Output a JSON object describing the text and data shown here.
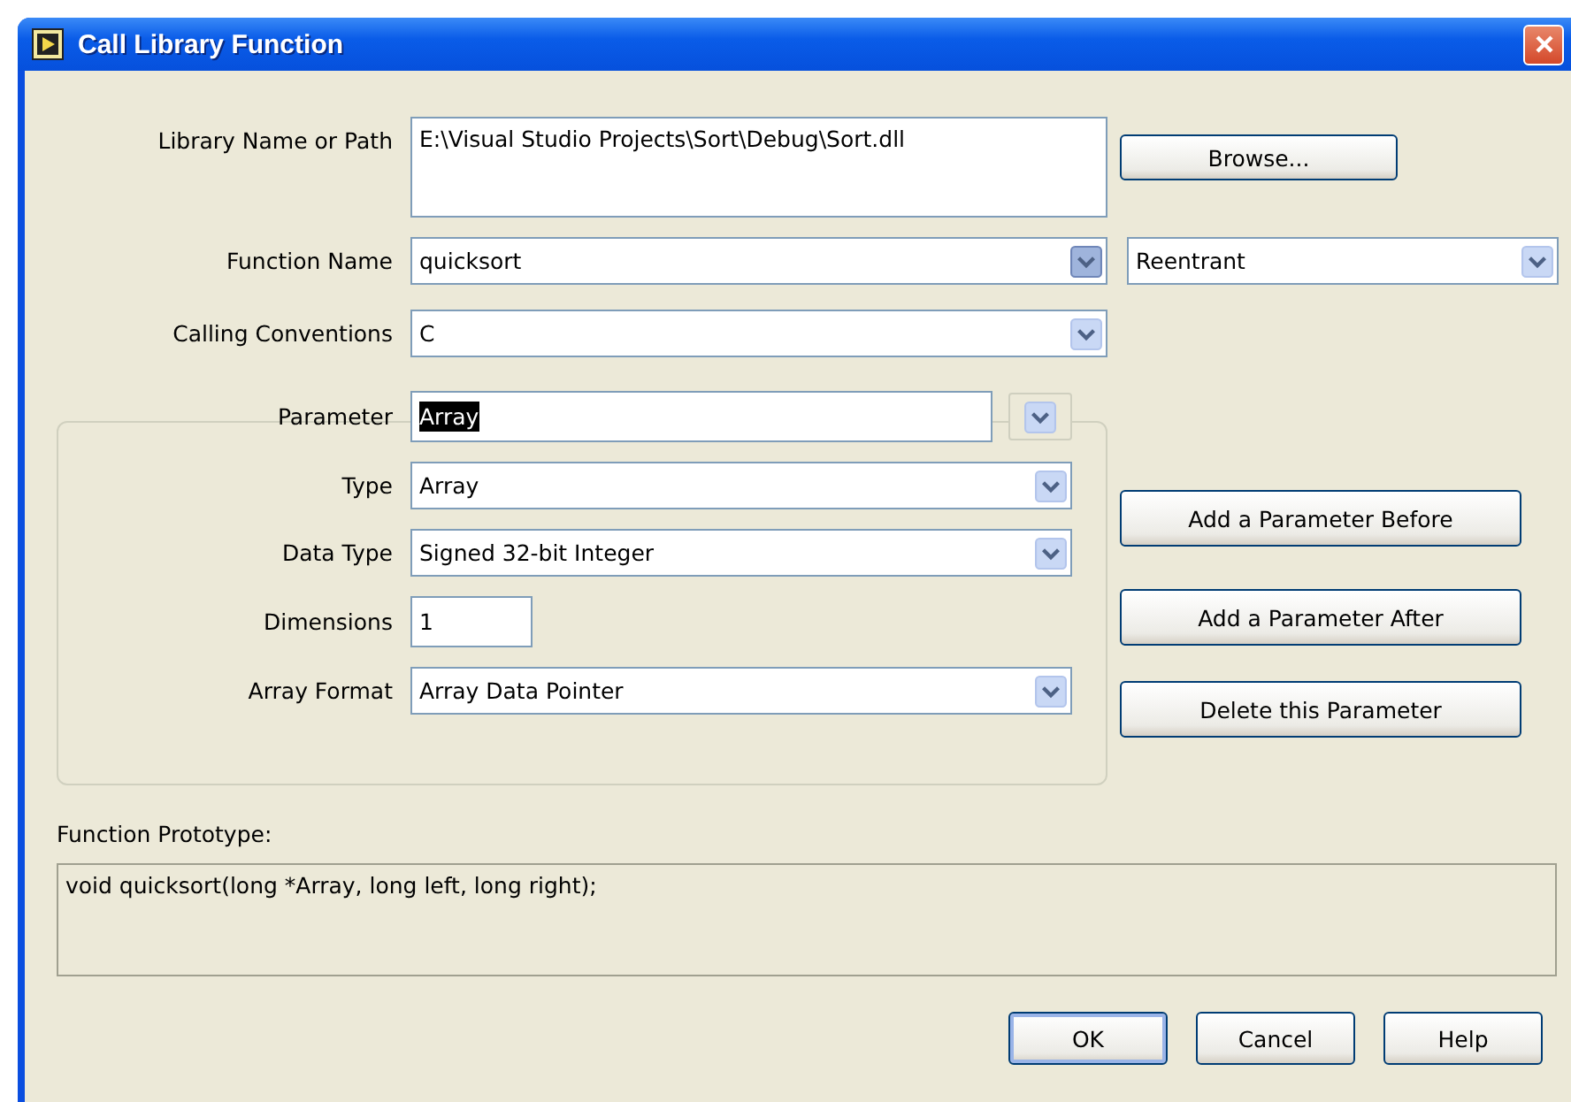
{
  "window": {
    "title": "Call Library Function"
  },
  "library": {
    "label": "Library Name or Path",
    "value": "E:\\Visual Studio Projects\\Sort\\Debug\\Sort.dll"
  },
  "browse_button": "Browse...",
  "function_name": {
    "label": "Function Name",
    "value": "quicksort",
    "pressed": true
  },
  "thread_mode": {
    "value": "Reentrant"
  },
  "calling_conventions": {
    "label": "Calling Conventions",
    "value": "C"
  },
  "parameter": {
    "label": "Parameter",
    "value": "Array",
    "selected": true
  },
  "parameter_fields": [
    {
      "label": "Type",
      "value": "Array",
      "kind": "dropdown"
    },
    {
      "label": "Data Type",
      "value": "Signed 32-bit Integer",
      "kind": "dropdown"
    },
    {
      "label": "Dimensions",
      "value": "1",
      "kind": "number"
    },
    {
      "label": "Array Format",
      "value": "Array Data Pointer",
      "kind": "dropdown"
    }
  ],
  "parameter_buttons": [
    "Add a Parameter Before",
    "Add a Parameter After",
    "Delete this Parameter"
  ],
  "prototype": {
    "label": "Function Prototype:",
    "value": "void quicksort(long *Array, long left, long right);"
  },
  "buttons": [
    {
      "label": "OK",
      "default": true
    },
    {
      "label": "Cancel",
      "default": false
    },
    {
      "label": "Help",
      "default": false
    }
  ]
}
